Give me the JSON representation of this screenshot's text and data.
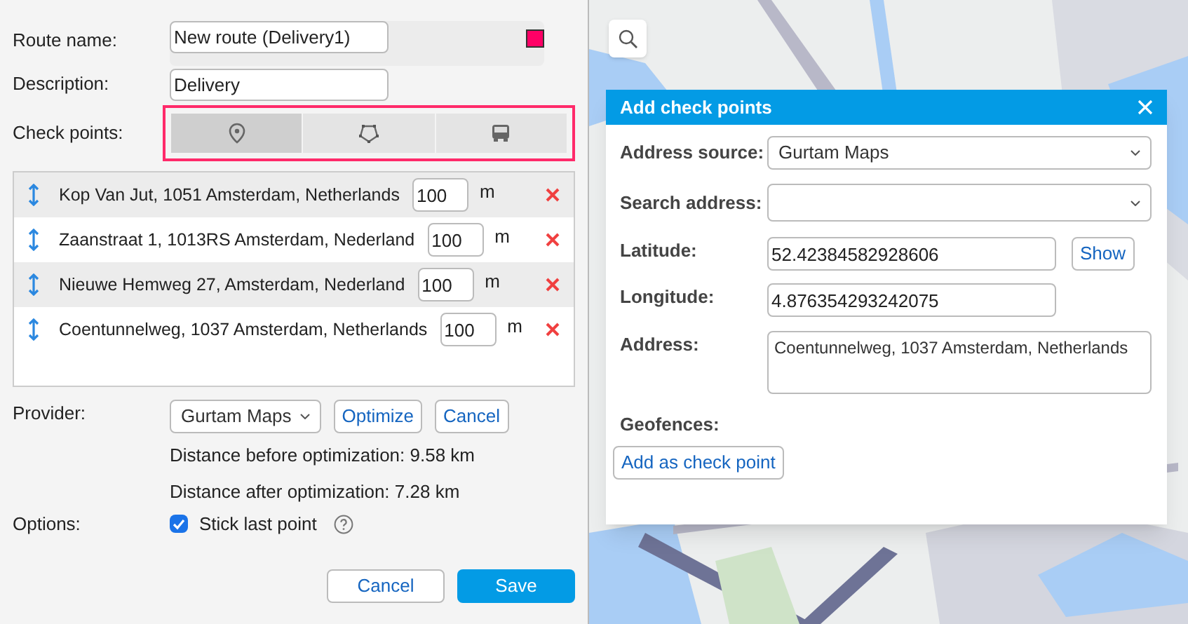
{
  "route_form": {
    "route_name": {
      "label": "Route name:",
      "value": "New route (Delivery1)",
      "color": "#ff0066"
    },
    "description": {
      "label": "Description:",
      "value": "Delivery"
    },
    "check_points": {
      "label": "Check points:",
      "modes": [
        {
          "kind": "point",
          "selected": true
        },
        {
          "kind": "geofence",
          "selected": false
        },
        {
          "kind": "unit",
          "selected": false
        }
      ]
    },
    "points": [
      {
        "address": "Kop Van Jut, 1051 Amsterdam, Netherlands",
        "radius": "100",
        "unit": "m"
      },
      {
        "address": "Zaanstraat 1, 1013RS Amsterdam, Nederland",
        "radius": "100",
        "unit": "m"
      },
      {
        "address": "Nieuwe Hemweg 27, Amsterdam, Nederland",
        "radius": "100",
        "unit": "m"
      },
      {
        "address": "Coentunnelweg, 1037 Amsterdam, Netherlands",
        "radius": "100",
        "unit": "m"
      }
    ],
    "provider": {
      "label": "Provider:",
      "value": "Gurtam Maps",
      "buttons": [
        "Optimize",
        "Cancel"
      ]
    },
    "distance_before": "Distance before optimization: 9.58 km",
    "distance_after": "Distance after optimization: 7.28 km",
    "options": {
      "label": "Options:",
      "stick_last_point": {
        "label": "Stick last point",
        "checked": true
      }
    },
    "buttons": [
      "Cancel",
      "Save"
    ]
  },
  "dialog": {
    "title": "Add check points",
    "address_source": {
      "label": "Address source:",
      "value": "Gurtam Maps"
    },
    "search_address": {
      "label": "Search address:"
    },
    "latitude": {
      "label": "Latitude:",
      "value": "52.42384582928606",
      "button": "Show"
    },
    "longitude": {
      "label": "Longitude:",
      "value": "4.876354293242075"
    },
    "address": {
      "label": "Address:",
      "value": "Coentunnelweg, 1037 Amsterdam, Netherlands"
    },
    "geofences": {
      "label": "Geofences:"
    },
    "button": "Add as check point"
  }
}
